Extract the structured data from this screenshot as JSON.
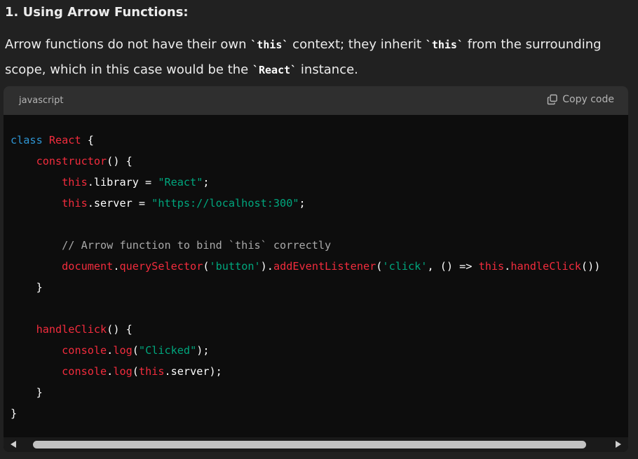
{
  "heading": "1. Using Arrow Functions:",
  "paragraph": {
    "line1_part1": "Arrow functions do not have their own ",
    "line1_code1": "`this`",
    "line1_part2": " context; they inherit ",
    "line1_code2": "`this`",
    "line1_part3": " from the surrounding",
    "line2_part1": "scope, which in this case would be the ",
    "line2_code1": "`React`",
    "line2_part2": " instance."
  },
  "code_block": {
    "language": "javascript",
    "copy_label": "Copy code",
    "lines": [
      [
        {
          "t": "class ",
          "c": "keyword"
        },
        {
          "t": "React",
          "c": "name"
        },
        {
          "t": " {",
          "c": "plain"
        }
      ],
      [
        {
          "t": "    ",
          "c": "plain"
        },
        {
          "t": "constructor",
          "c": "name"
        },
        {
          "t": "() {",
          "c": "plain"
        }
      ],
      [
        {
          "t": "        ",
          "c": "plain"
        },
        {
          "t": "this",
          "c": "name"
        },
        {
          "t": ".library = ",
          "c": "plain"
        },
        {
          "t": "\"React\"",
          "c": "string"
        },
        {
          "t": ";",
          "c": "plain"
        }
      ],
      [
        {
          "t": "        ",
          "c": "plain"
        },
        {
          "t": "this",
          "c": "name"
        },
        {
          "t": ".server = ",
          "c": "plain"
        },
        {
          "t": "\"https://localhost:300\"",
          "c": "string"
        },
        {
          "t": ";",
          "c": "plain"
        }
      ],
      [],
      [
        {
          "t": "        ",
          "c": "plain"
        },
        {
          "t": "// Arrow function to bind `this` correctly",
          "c": "comment"
        }
      ],
      [
        {
          "t": "        ",
          "c": "plain"
        },
        {
          "t": "document",
          "c": "name"
        },
        {
          "t": ".",
          "c": "plain"
        },
        {
          "t": "querySelector",
          "c": "name"
        },
        {
          "t": "(",
          "c": "plain"
        },
        {
          "t": "'button'",
          "c": "string"
        },
        {
          "t": ").",
          "c": "plain"
        },
        {
          "t": "addEventListener",
          "c": "name"
        },
        {
          "t": "(",
          "c": "plain"
        },
        {
          "t": "'click'",
          "c": "string"
        },
        {
          "t": ", () => ",
          "c": "plain"
        },
        {
          "t": "this",
          "c": "name"
        },
        {
          "t": ".",
          "c": "plain"
        },
        {
          "t": "handleClick",
          "c": "name"
        },
        {
          "t": "())",
          "c": "plain"
        }
      ],
      [
        {
          "t": "    }",
          "c": "plain"
        }
      ],
      [],
      [
        {
          "t": "    ",
          "c": "plain"
        },
        {
          "t": "handleClick",
          "c": "name"
        },
        {
          "t": "() {",
          "c": "plain"
        }
      ],
      [
        {
          "t": "        ",
          "c": "plain"
        },
        {
          "t": "console",
          "c": "name"
        },
        {
          "t": ".",
          "c": "plain"
        },
        {
          "t": "log",
          "c": "name"
        },
        {
          "t": "(",
          "c": "plain"
        },
        {
          "t": "\"Clicked\"",
          "c": "string"
        },
        {
          "t": ");",
          "c": "plain"
        }
      ],
      [
        {
          "t": "        ",
          "c": "plain"
        },
        {
          "t": "console",
          "c": "name"
        },
        {
          "t": ".",
          "c": "plain"
        },
        {
          "t": "log",
          "c": "name"
        },
        {
          "t": "(",
          "c": "plain"
        },
        {
          "t": "this",
          "c": "name"
        },
        {
          "t": ".server);",
          "c": "plain"
        }
      ],
      [
        {
          "t": "    }",
          "c": "plain"
        }
      ],
      [
        {
          "t": "}",
          "c": "plain"
        }
      ]
    ]
  },
  "colors": {
    "keyword": "#2e95d3",
    "name": "#f22c3d",
    "string": "#00a67d",
    "comment": "#a9a9a9",
    "plain": "#ffffff"
  },
  "icons": {
    "copy": "copy-icon",
    "scroll_left": "scroll-left-icon",
    "scroll_right": "scroll-right-icon"
  },
  "scroll": {
    "thumb_fraction": 0.89
  }
}
